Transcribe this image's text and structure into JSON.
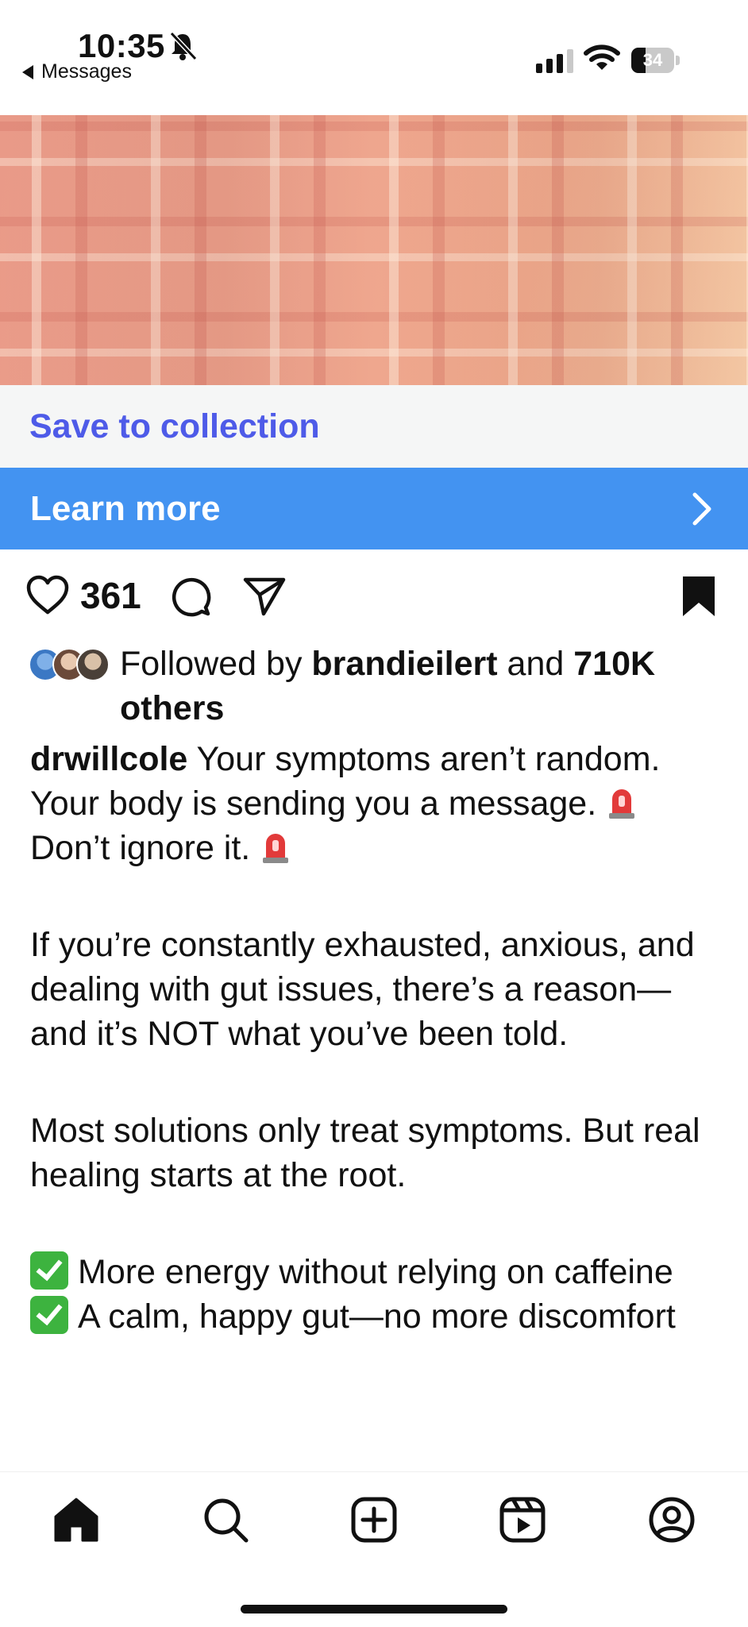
{
  "status_bar": {
    "time": "10:35",
    "back_label": "Messages",
    "battery_level": "34",
    "icons": [
      "bell-slash-icon",
      "signal-icon",
      "wifi-icon",
      "battery-icon"
    ]
  },
  "ad": {
    "save_label": "Save to collection",
    "cta_label": "Learn more",
    "cta_color": "#4393f1",
    "save_color": "#4e5be8"
  },
  "actions": {
    "like_count": "361",
    "icons": [
      "heart-icon",
      "comment-icon",
      "share-icon",
      "bookmark-icon"
    ]
  },
  "followed": {
    "prefix": "Followed by",
    "user": "brandieilert",
    "connector": "and",
    "count": "710K",
    "suffix": "others"
  },
  "post": {
    "username": "drwillcole",
    "line1": "Your symptoms aren’t random. Your body is sending you a message.",
    "line2": "Don’t ignore it.",
    "para2": "If you’re constantly exhausted, anxious, and dealing with gut issues, there’s a reason—and it’s NOT what you’ve been told.",
    "para3": "Most solutions only treat symptoms. But real healing starts at the root.",
    "bullets": [
      "More energy without relying on caffeine",
      "A calm, happy gut—no more discomfort"
    ]
  },
  "bottom_nav": {
    "items": [
      "home-icon",
      "search-icon",
      "create-icon",
      "reels-icon",
      "profile-icon"
    ]
  }
}
